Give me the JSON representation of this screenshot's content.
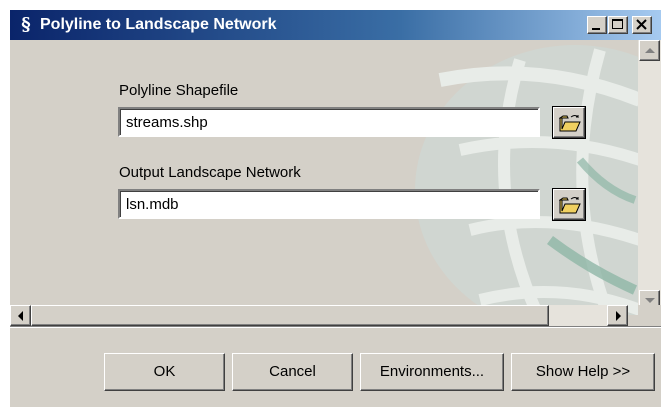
{
  "window": {
    "title": "Polyline to Landscape Network",
    "app_icon": "arcgis-s-icon"
  },
  "title_controls": {
    "minimize": "minimize-icon",
    "maximize": "maximize-icon",
    "close": "close-icon"
  },
  "form": {
    "polyline_label": "Polyline Shapefile",
    "polyline_value": "streams.shp",
    "output_label": "Output Landscape Network",
    "output_value": "lsn.mdb",
    "browse_icon": "open-folder-icon"
  },
  "buttons": {
    "ok": "OK",
    "cancel": "Cancel",
    "environments": "Environments...",
    "help": "Show Help >>"
  },
  "colors": {
    "title_start": "#0a246a",
    "title_end": "#a6caf0",
    "face": "#d4d0c8"
  }
}
